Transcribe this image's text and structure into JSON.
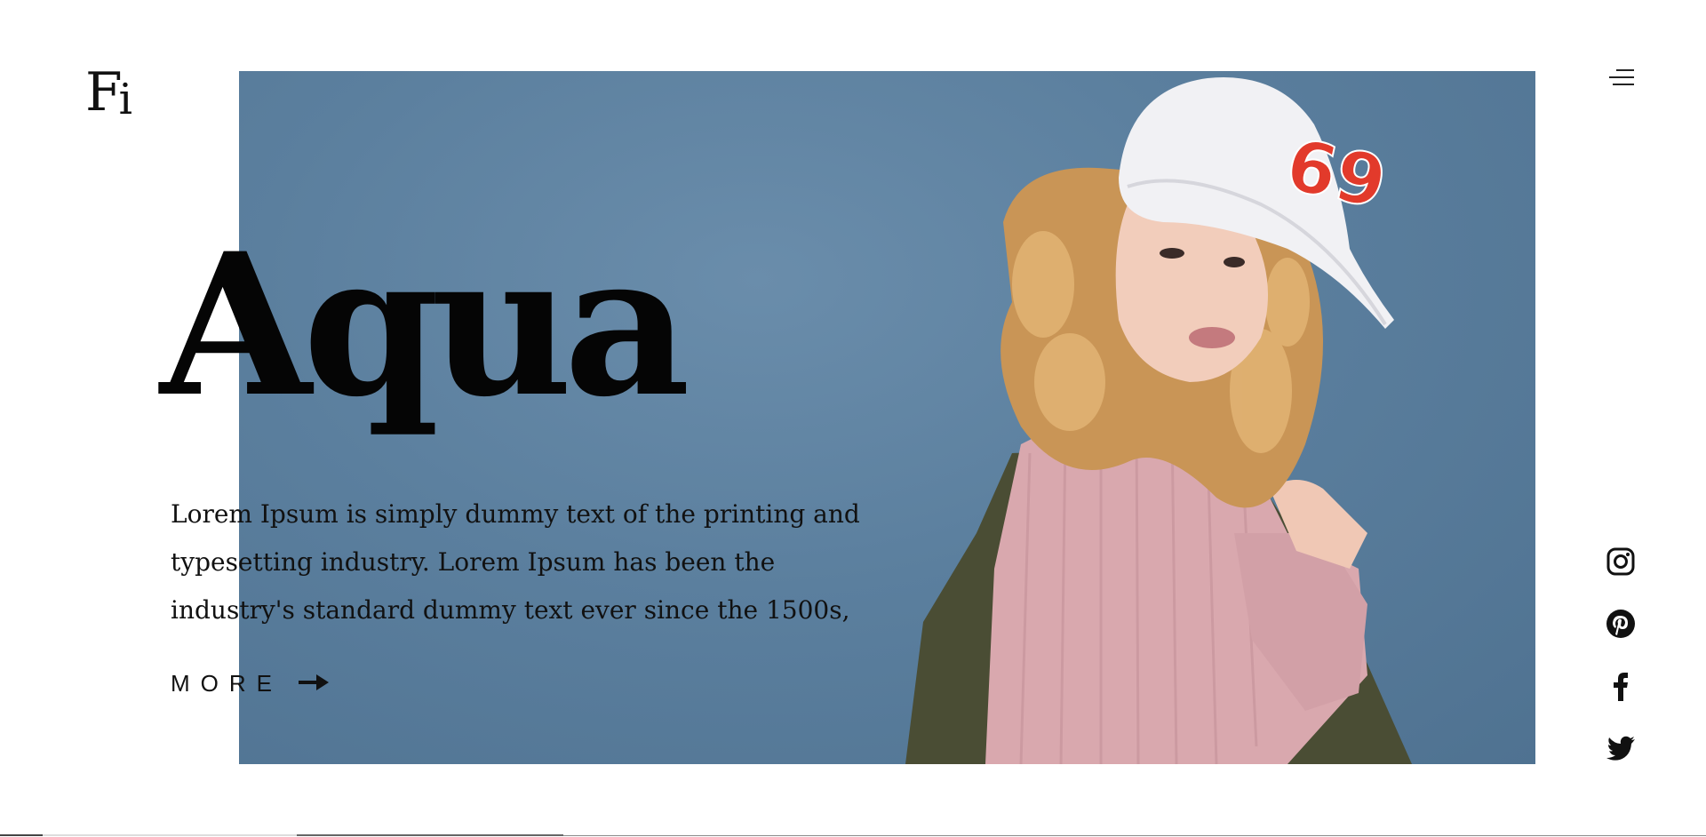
{
  "brand": {
    "logo_f": "F",
    "logo_i": "i"
  },
  "header": {
    "menu_icon": "hamburger-menu-icon"
  },
  "hero": {
    "title": "Aqua",
    "description": "Lorem Ipsum is simply dummy text of the printing and typesetting industry. Lorem Ipsum has been the industry's standard dummy text ever since the 1500s,",
    "more_label": "MORE",
    "more_icon": "arrow-right-icon",
    "cap_text": "69",
    "colors": {
      "background": "#5b7f9e",
      "sweater": "#d9a8ae",
      "cap": "#f1f1f4",
      "cap_number": "#e23a2b"
    }
  },
  "social": [
    {
      "name": "instagram",
      "icon": "instagram-icon"
    },
    {
      "name": "pinterest",
      "icon": "pinterest-icon"
    },
    {
      "name": "facebook",
      "icon": "facebook-icon"
    },
    {
      "name": "twitter",
      "icon": "twitter-icon"
    }
  ]
}
